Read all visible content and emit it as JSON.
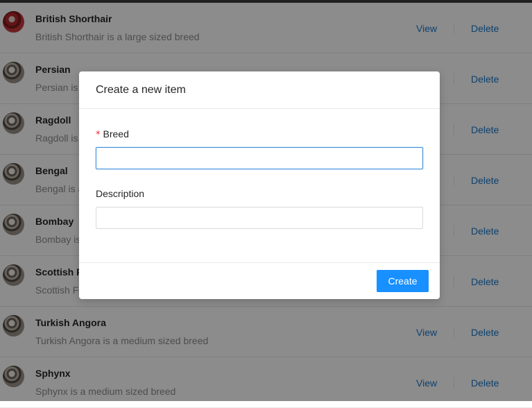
{
  "list": {
    "actions": {
      "view_label": "View",
      "delete_label": "Delete"
    },
    "items": [
      {
        "title": "British Shorthair",
        "description": "British Shorthair is a large sized breed",
        "avatar": "cat-photo-red"
      },
      {
        "title": "Persian",
        "description": "Persian is a medium sized breed",
        "avatar": "cat-photo"
      },
      {
        "title": "Ragdoll",
        "description": "Ragdoll is a large sized breed",
        "avatar": "cat-photo"
      },
      {
        "title": "Bengal",
        "description": "Bengal is a medium sized breed",
        "avatar": "cat-photo"
      },
      {
        "title": "Bombay",
        "description": "Bombay is a medium sized breed",
        "avatar": "cat-photo"
      },
      {
        "title": "Scottish Fold",
        "description": "Scottish Fold is a medium sized breed",
        "avatar": "cat-photo"
      },
      {
        "title": "Turkish Angora",
        "description": "Turkish Angora is a medium sized breed",
        "avatar": "cat-photo"
      },
      {
        "title": "Sphynx",
        "description": "Sphynx is a medium sized breed",
        "avatar": "cat-photo"
      }
    ]
  },
  "modal": {
    "title": "Create a new item",
    "breed": {
      "required_mark": "*",
      "label": "Breed",
      "value": "",
      "placeholder": ""
    },
    "description": {
      "label": "Description",
      "value": "",
      "placeholder": ""
    },
    "create_label": "Create"
  },
  "colors": {
    "primary": "#1890ff",
    "link": "#1677c8",
    "required": "#f5222d"
  }
}
